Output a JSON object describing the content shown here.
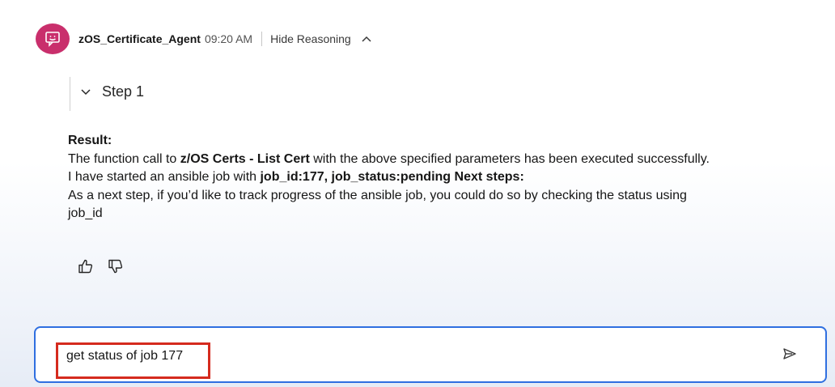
{
  "message": {
    "agent_name": "zOS_Certificate_Agent",
    "time": "09:20 AM",
    "hide_reasoning_label": "Hide Reasoning",
    "step_label": "Step 1",
    "avatar_icon": "chat-bot-icon",
    "result": {
      "heading": "Result:",
      "line1_pre": "The function call to ",
      "line1_bold": "z/OS Certs - List Cert",
      "line1_post": " with the above specified parameters has been executed successfully.",
      "line2_pre": "I have started an ansible job with ",
      "line2_bold1": "job_id:177, job_status:pending",
      "line2_bold2": "Next steps:",
      "line3": "As a next step, if you’d like to track progress of the ansible job, you could do so by checking the status using",
      "line4": "job_id"
    },
    "feedback": {
      "thumbs_up_icon": "thumbs-up-icon",
      "thumbs_down_icon": "thumbs-down-icon"
    }
  },
  "input": {
    "value": "get status of job 177",
    "send_icon": "send-icon"
  },
  "colors": {
    "avatar": "#c92f6c",
    "input_border": "#2f6fe0",
    "highlight_box": "#d52b1e"
  }
}
